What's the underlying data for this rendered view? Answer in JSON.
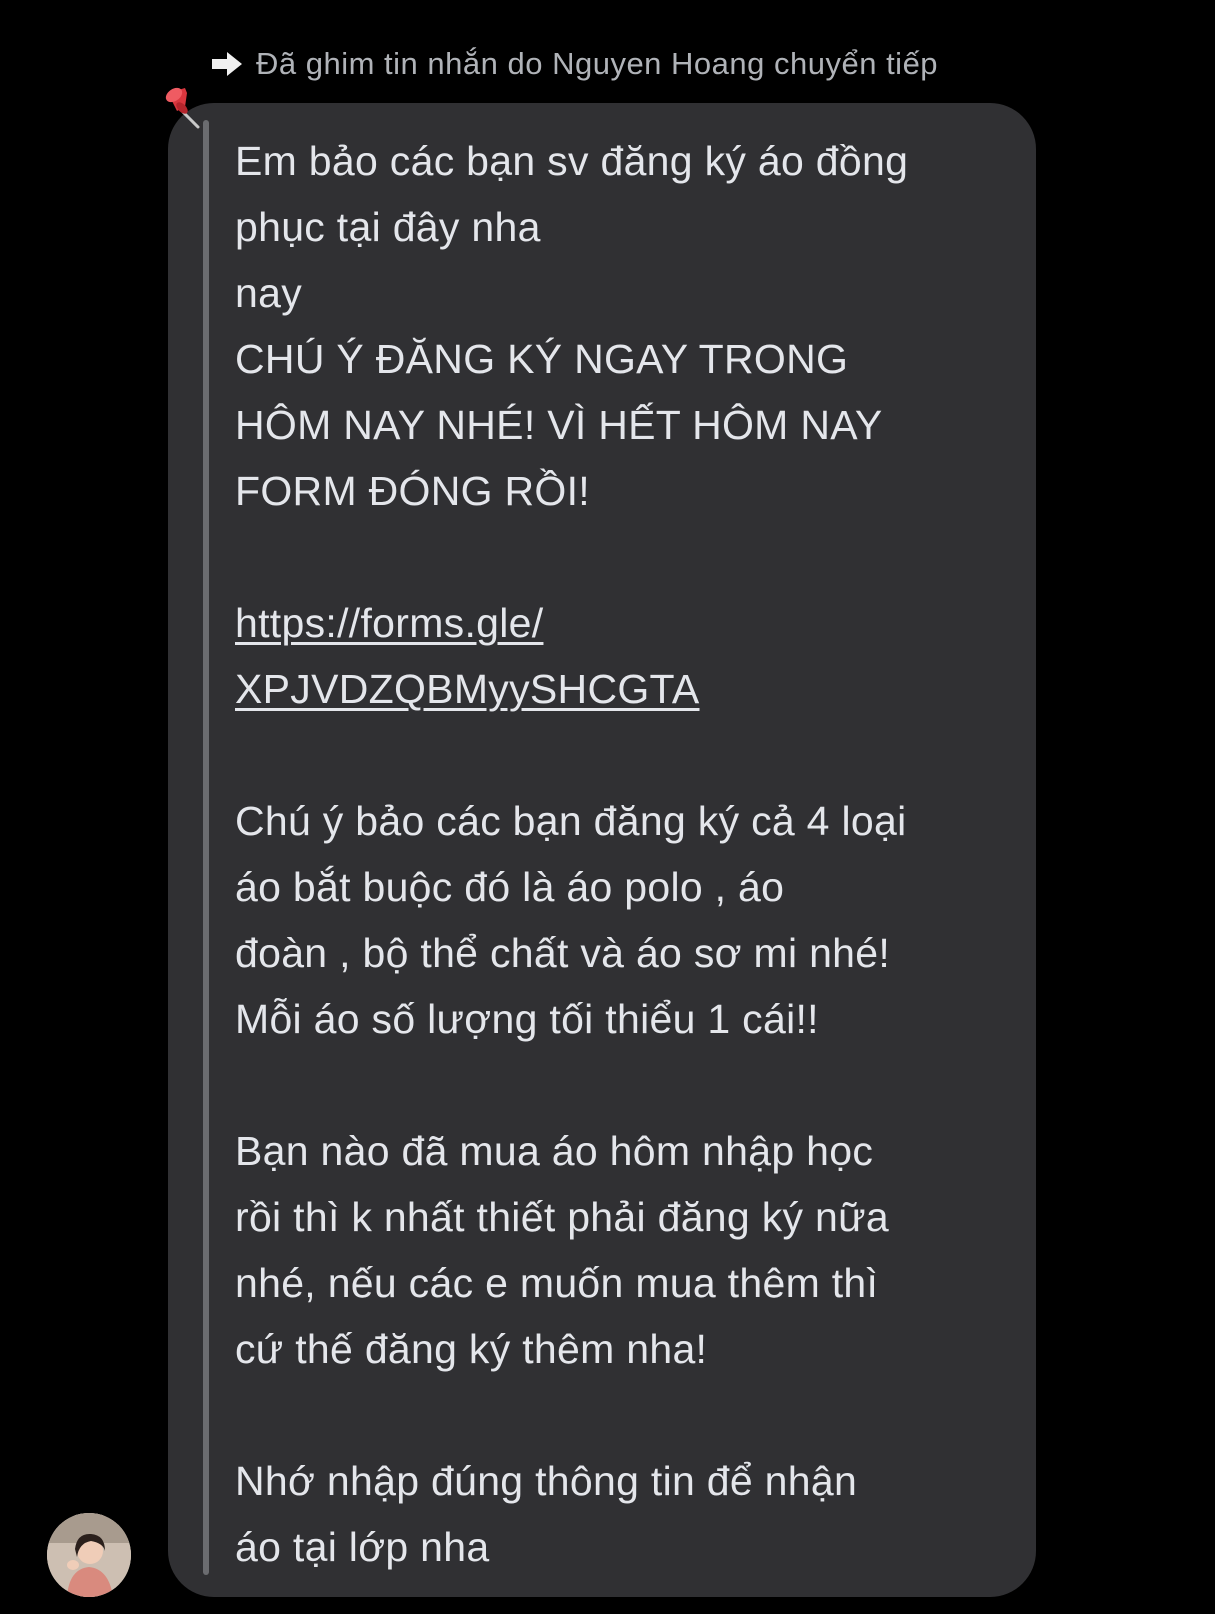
{
  "header": {
    "forward_notice": "Đã ghim tin nhắn do Nguyen Hoang chuyển tiếp",
    "forward_icon": "forward-arrow-icon",
    "pin_icon": "pushpin-icon"
  },
  "message": {
    "para1_line1": "Em bảo các bạn sv đăng ký áo đồng",
    "para1_line2": "phục tại đây nha",
    "para1_line3": "nay",
    "para1_line4": "CHÚ Ý ĐĂNG KÝ NGAY TRONG",
    "para1_line5": "HÔM NAY NHÉ! VÌ HẾT HÔM NAY",
    "para1_line6": "FORM ĐÓNG RỒI!",
    "link_line1": "https://forms.gle/",
    "link_line2": "XPJVDZQBMyySHCGTA",
    "para2_line1": "Chú ý bảo các bạn đăng ký cả 4 loại",
    "para2_line2": "áo bắt buộc đó là áo polo , áo",
    "para2_line3": "đoàn , bộ thể chất và áo sơ mi nhé!",
    "para2_line4": "Mỗi áo số lượng tối thiểu 1 cái!!",
    "para3_line1": "Bạn nào đã mua áo hôm nhập học",
    "para3_line2": "rồi thì k nhất thiết phải đăng ký nữa",
    "para3_line3": "nhé, nếu các e muốn mua thêm thì",
    "para3_line4": "cứ thế đăng ký thêm nha!",
    "para4_line1": "Nhớ nhập đúng thông tin để nhận",
    "para4_line2": "áo tại lớp nha"
  },
  "colors": {
    "background": "#000000",
    "bubble": "#303033",
    "text": "#e4e6eb",
    "muted": "#b0b3b8"
  }
}
